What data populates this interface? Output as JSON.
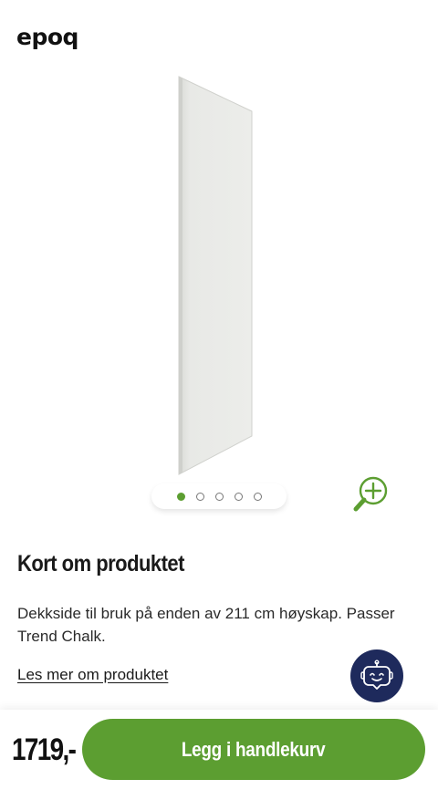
{
  "header": {
    "logo_text": "epoq"
  },
  "gallery": {
    "image_count": 5,
    "active_index": 0,
    "zoom_icon": "zoom-in-icon",
    "accent_color": "#5c9e31"
  },
  "product": {
    "section_title": "Kort om produktet",
    "description": "Dekkside til bruk på enden av 211 cm høyskap. Passer Trend Chalk.",
    "read_more_label": "Les mer om produktet"
  },
  "chat": {
    "icon": "chatbot-icon",
    "background_color": "#1e2a5c"
  },
  "purchase": {
    "price": "1719,-",
    "add_to_cart_label": "Legg i handlekurv",
    "button_color": "#5c9e31"
  }
}
